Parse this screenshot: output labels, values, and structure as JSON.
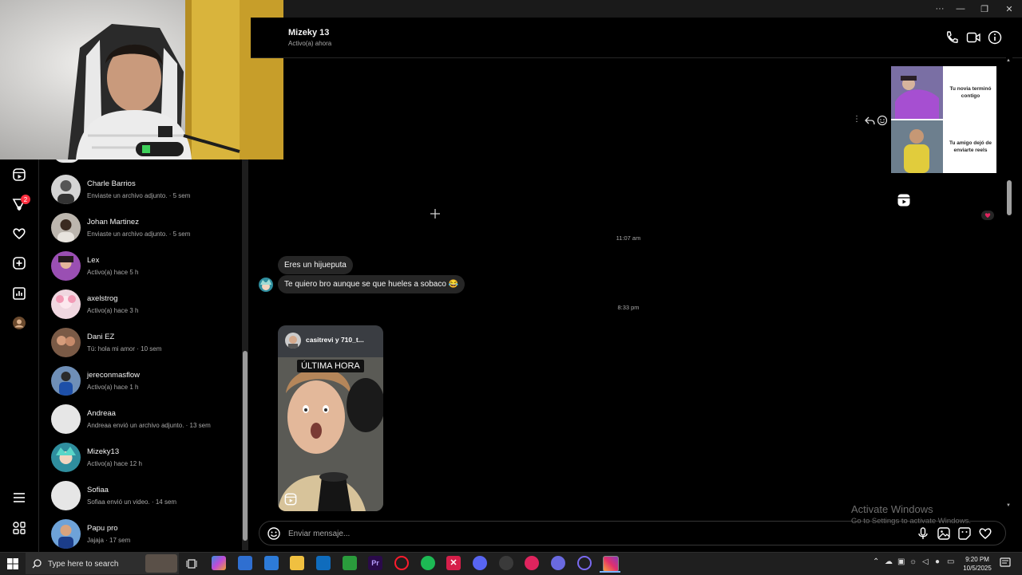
{
  "chat": {
    "name": "Mizeky 13",
    "status": "Activo(a) ahora"
  },
  "conversations": [
    {
      "name": "Charle Barrios",
      "sub": "Enviaste un archivo adjunto. · 5 sem"
    },
    {
      "name": "Johan Martinez",
      "sub": "Enviaste un archivo adjunto. · 5 sem"
    },
    {
      "name": "Lex",
      "sub": "Activo(a) hace 5 h"
    },
    {
      "name": "axelstrog",
      "sub": "Activo(a) hace 3 h"
    },
    {
      "name": "Dani EZ",
      "sub": "Tú: hola mi amor · 10 sem"
    },
    {
      "name": "jereconmasflow",
      "sub": "Activo(a) hace 1 h"
    },
    {
      "name": "Andreaa",
      "sub": "Andreaa envió un archivo adjunto. · 13 sem"
    },
    {
      "name": "Mizeky13",
      "sub": "Activo(a) hace 12 h"
    },
    {
      "name": "Sofiaa",
      "sub": "Sofiaa envió un video. · 14 sem"
    },
    {
      "name": "Papu pro",
      "sub": "Jajaja · 17 sem"
    }
  ],
  "rail": {
    "notification_count": "2"
  },
  "meme": {
    "caption_top": "Tu novia terminó contigo",
    "caption_bottom": "Tu amigo dejó de enviarte reels"
  },
  "messages": {
    "time1": "11:07 am",
    "msg1": "Eres un hijueputa",
    "msg2": "Te quiero bro aunque se que hueles a sobaco 😂",
    "time2": "8:33 pm",
    "reel_user": "casitrevi y 710_t...",
    "reel_tag": "ÚLTIMA HORA"
  },
  "composer": {
    "placeholder": "Enviar mensaje..."
  },
  "watermark": {
    "line1": "Activate Windows",
    "line2": "Go to Settings to activate Windows."
  },
  "taskbar": {
    "search_placeholder": "Type here to search",
    "time": "9:20 PM",
    "date": "10/5/2025"
  },
  "colors": {
    "accent_red": "#ff3040",
    "instagram_pink": "#e1306c"
  }
}
